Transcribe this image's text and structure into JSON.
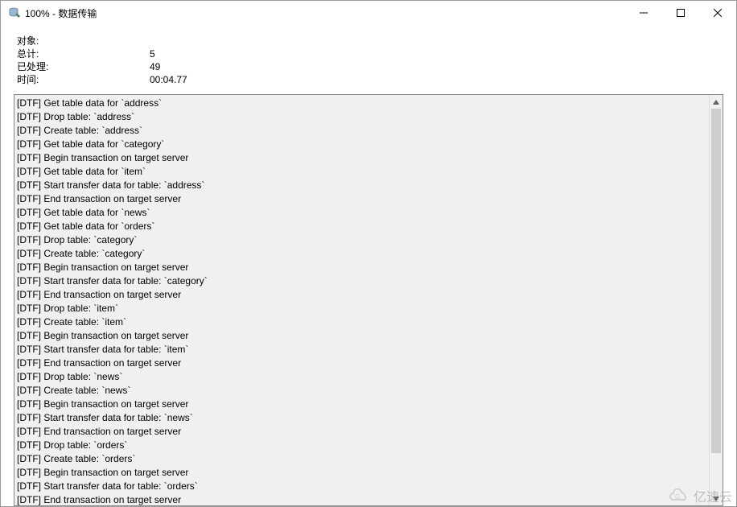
{
  "window": {
    "title": "100% - 数据传输"
  },
  "stats": {
    "labels": {
      "object": "对象:",
      "total": "总计:",
      "processed": "已处理:",
      "time": "时间:"
    },
    "values": {
      "object": "",
      "total": "5",
      "processed": "49",
      "time": "00:04.77"
    }
  },
  "log": [
    "[DTF] Get table data for `address`",
    "[DTF] Drop table: `address`",
    "[DTF] Create table: `address`",
    "[DTF] Get table data for `category`",
    "[DTF] Begin transaction on target server",
    "[DTF] Get table data for `item`",
    "[DTF] Start transfer data for table: `address`",
    "[DTF] End transaction on target server",
    "[DTF] Get table data for `news`",
    "[DTF] Get table data for `orders`",
    "[DTF] Drop table: `category`",
    "[DTF] Create table: `category`",
    "[DTF] Begin transaction on target server",
    "[DTF] Start transfer data for table: `category`",
    "[DTF] End transaction on target server",
    "[DTF] Drop table: `item`",
    "[DTF] Create table: `item`",
    "[DTF] Begin transaction on target server",
    "[DTF] Start transfer data for table: `item`",
    "[DTF] End transaction on target server",
    "[DTF] Drop table: `news`",
    "[DTF] Create table: `news`",
    "[DTF] Begin transaction on target server",
    "[DTF] Start transfer data for table: `news`",
    "[DTF] End transaction on target server",
    "[DTF] Drop table: `orders`",
    "[DTF] Create table: `orders`",
    "[DTF] Begin transaction on target server",
    "[DTF] Start transfer data for table: `orders`",
    "[DTF] End transaction on target server"
  ],
  "watermark": {
    "text": "亿速云"
  }
}
